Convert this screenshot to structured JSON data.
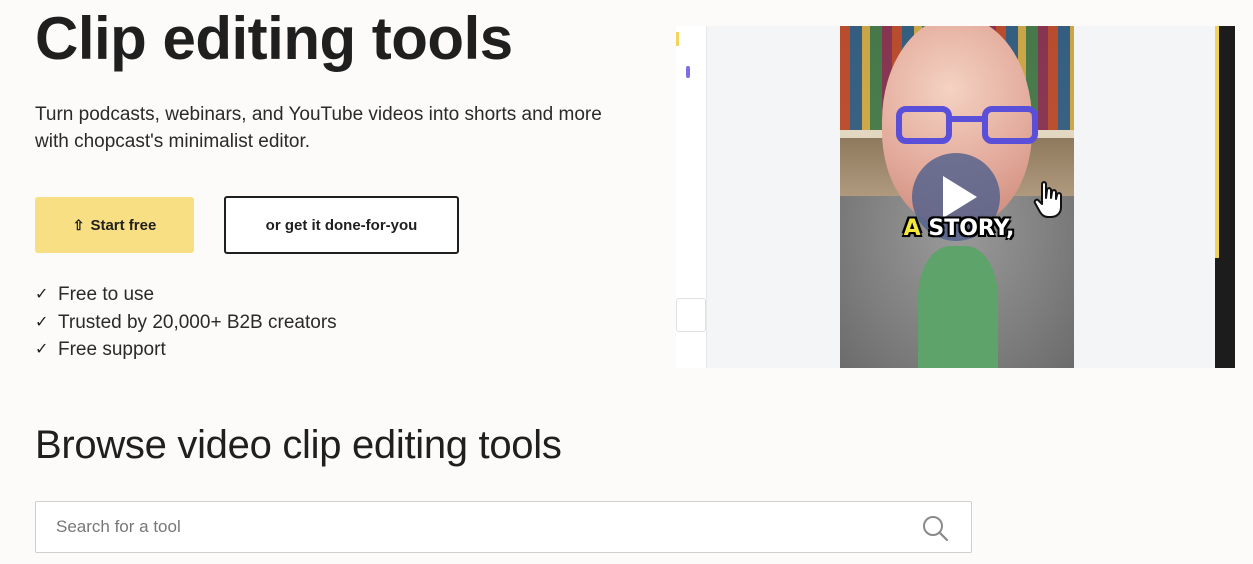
{
  "hero": {
    "title": "Clip editing tools",
    "subtitle": "Turn podcasts, webinars, and YouTube videos into shorts and more with chopcast's minimalist editor.",
    "primary_cta": {
      "icon": "upload-arrow-icon",
      "icon_glyph": "⇧",
      "label": "Start free"
    },
    "secondary_cta": {
      "label": "or get it done-for-you"
    },
    "features": [
      {
        "icon": "check-icon",
        "label": "Free to use"
      },
      {
        "icon": "check-icon",
        "label": "Trusted by 20,000+ B2B creators"
      },
      {
        "icon": "check-icon",
        "label": "Free support"
      }
    ]
  },
  "video": {
    "caption_highlight": "A",
    "caption_rest": " STORY,"
  },
  "browse": {
    "title": "Browse video clip editing tools",
    "search_placeholder": "Search for a tool"
  },
  "colors": {
    "primary_button": "#f9df83",
    "text": "#1f1f1f",
    "background": "#fcfbfa",
    "glasses": "#5a4fd8"
  }
}
